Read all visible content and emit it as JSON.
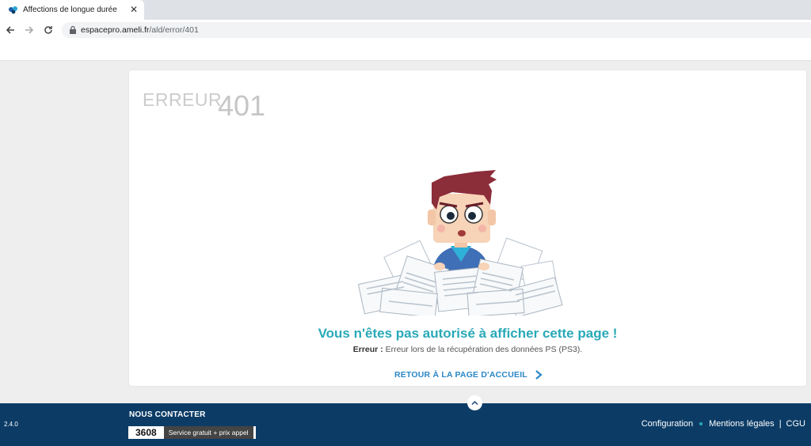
{
  "browser": {
    "tab_title": "Affections de longue durée",
    "tab_close": "✕",
    "url_host": "espacepro.ameli.fr",
    "url_path": "/ald/error/401"
  },
  "error": {
    "word": "ERREUR",
    "code": "401",
    "title": "Vous n'êtes pas autorisé à afficher cette page !",
    "detail_label": "Erreur :",
    "detail_text": "Erreur lors de la récupération des données PS (PS3).",
    "home_link": "RETOUR À LA PAGE D'ACCUEIL"
  },
  "footer": {
    "version": "2.4.0",
    "contact_title": "NOUS CONTACTER",
    "phone_number": "3608",
    "phone_note": "Service gratuit + prix appel",
    "links": [
      "Configuration",
      "Mentions légales",
      "CGU"
    ],
    "link_separator": "|"
  },
  "colors": {
    "accent_teal": "#29a9b8",
    "link_blue": "#2b87c6",
    "footer_bg": "#0c3c66"
  }
}
